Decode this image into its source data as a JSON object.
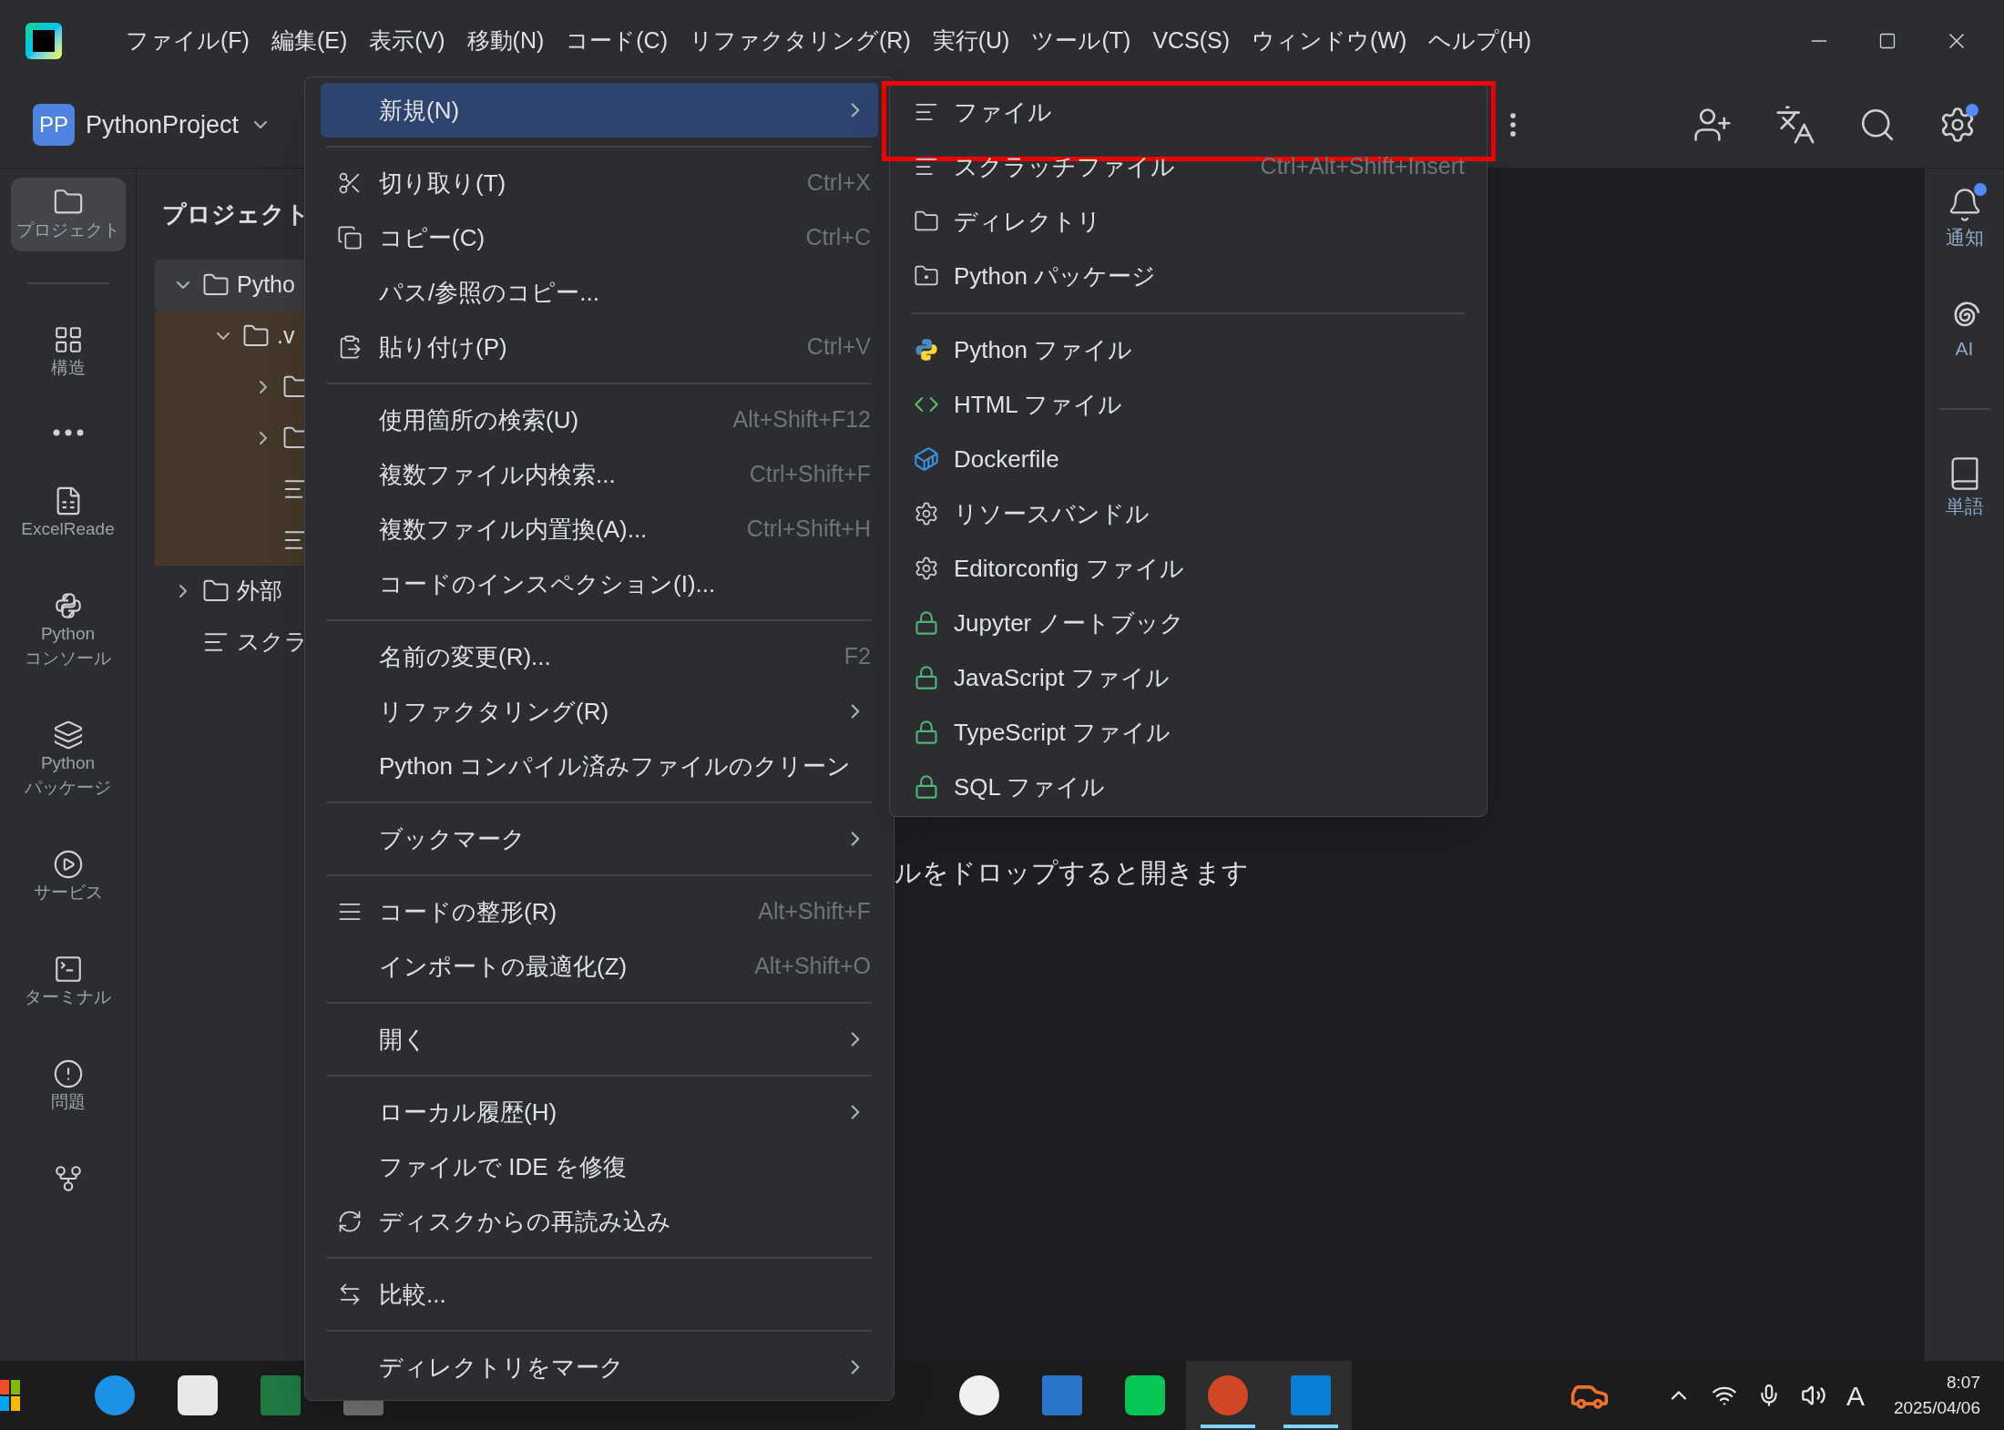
{
  "title_bar": {
    "menu": [
      "ファイル(F)",
      "編集(E)",
      "表示(V)",
      "移動(N)",
      "コード(C)",
      "リファクタリング(R)",
      "実行(U)",
      "ツール(T)",
      "VCS(S)",
      "ウィンドウ(W)",
      "ヘルプ(H)"
    ]
  },
  "toolbar": {
    "project_badge": "PP",
    "project_name": "PythonProject",
    "settings_dot": true
  },
  "left_tools": [
    {
      "lines": [
        "プロジェクト"
      ],
      "selected": true
    },
    {
      "lines": [
        "構造"
      ],
      "selected": false
    },
    {
      "selected": false
    },
    {
      "lines": [
        "ExcelReade"
      ],
      "selected": false
    },
    {
      "lines": [
        "Python",
        "コンソール"
      ],
      "selected": false
    },
    {
      "lines": [
        "Python",
        "パッケージ"
      ],
      "selected": false
    },
    {
      "lines": [
        "サービス"
      ],
      "selected": false
    },
    {
      "lines": [
        "ターミナル"
      ],
      "selected": false
    },
    {
      "lines": [
        "問題"
      ],
      "selected": false
    },
    {
      "selected": false
    }
  ],
  "project_panel": {
    "title": "プロジェクト",
    "tree": [
      {
        "label": "Pytho",
        "expanded": true,
        "selected": true,
        "excluded": false,
        "children": [
          {
            "label": ".v",
            "expanded": true,
            "selected": false,
            "excluded": true,
            "children": [
              {
                "expanded": false,
                "selected": false
              },
              {
                "expanded": false,
                "selected": false
              },
              {
                "selected": false
              },
              {
                "selected": false
              }
            ]
          }
        ]
      },
      {
        "label": "外部",
        "expanded": false,
        "selected": false,
        "excluded": false
      },
      {
        "label": "スクラ",
        "selected": false,
        "excluded": false
      }
    ]
  },
  "editor": {
    "hint": "ルをドロップすると開きます"
  },
  "context_menu": {
    "items": [
      {
        "kind": "item",
        "label": "新規(N)",
        "submenu": true,
        "selected": true
      },
      {
        "kind": "separator"
      },
      {
        "kind": "item",
        "label": "切り取り(T)",
        "shortcut": "Ctrl+X",
        "submenu": false,
        "selected": false
      },
      {
        "kind": "item",
        "label": "コピー(C)",
        "shortcut": "Ctrl+C",
        "submenu": false,
        "selected": false
      },
      {
        "kind": "item",
        "label": "パス/参照のコピー...",
        "submenu": false,
        "selected": false
      },
      {
        "kind": "item",
        "label": "貼り付け(P)",
        "shortcut": "Ctrl+V",
        "submenu": false,
        "selected": false
      },
      {
        "kind": "separator"
      },
      {
        "kind": "item",
        "label": "使用箇所の検索(U)",
        "shortcut": "Alt+Shift+F12",
        "submenu": false,
        "selected": false
      },
      {
        "kind": "item",
        "label": "複数ファイル内検索...",
        "shortcut": "Ctrl+Shift+F",
        "submenu": false,
        "selected": false
      },
      {
        "kind": "item",
        "label": "複数ファイル内置換(A)...",
        "shortcut": "Ctrl+Shift+H",
        "submenu": false,
        "selected": false
      },
      {
        "kind": "item",
        "label": "コードのインスペクション(I)...",
        "submenu": false,
        "selected": false
      },
      {
        "kind": "separator"
      },
      {
        "kind": "item",
        "label": "名前の変更(R)...",
        "shortcut": "F2",
        "submenu": false,
        "selected": false
      },
      {
        "kind": "item",
        "label": "リファクタリング(R)",
        "submenu": true,
        "selected": false
      },
      {
        "kind": "item",
        "label": "Python コンパイル済みファイルのクリーン",
        "submenu": false,
        "selected": false
      },
      {
        "kind": "separator"
      },
      {
        "kind": "item",
        "label": "ブックマーク",
        "submenu": true,
        "selected": false
      },
      {
        "kind": "separator"
      },
      {
        "kind": "item",
        "label": "コードの整形(R)",
        "shortcut": "Alt+Shift+F",
        "submenu": false,
        "selected": false
      },
      {
        "kind": "item",
        "label": "インポートの最適化(Z)",
        "shortcut": "Alt+Shift+O",
        "submenu": false,
        "selected": false
      },
      {
        "kind": "separator"
      },
      {
        "kind": "item",
        "label": "開く",
        "submenu": true,
        "selected": false
      },
      {
        "kind": "separator"
      },
      {
        "kind": "item",
        "label": "ローカル履歴(H)",
        "submenu": true,
        "selected": false
      },
      {
        "kind": "item",
        "label": "ファイルで IDE を修復",
        "submenu": false,
        "selected": false
      },
      {
        "kind": "item",
        "label": "ディスクからの再読み込み",
        "submenu": false,
        "selected": false
      },
      {
        "kind": "separator"
      },
      {
        "kind": "item",
        "label": "比較...",
        "submenu": false,
        "selected": false
      },
      {
        "kind": "separator"
      },
      {
        "kind": "item",
        "label": "ディレクトリをマーク",
        "submenu": true,
        "selected": false
      }
    ]
  },
  "submenu": {
    "items": [
      {
        "kind": "item",
        "label": "ファイル",
        "highlighted": true
      },
      {
        "kind": "item",
        "label": "スクラッチファイル",
        "shortcut": "Ctrl+Alt+Shift+Insert",
        "highlighted": false
      },
      {
        "kind": "item",
        "label": "ディレクトリ",
        "highlighted": false
      },
      {
        "kind": "item",
        "label": "Python パッケージ",
        "highlighted": false
      },
      {
        "kind": "separator"
      },
      {
        "kind": "item",
        "label": "Python ファイル",
        "highlighted": false
      },
      {
        "kind": "item",
        "label": "HTML ファイル",
        "highlighted": false
      },
      {
        "kind": "item",
        "label": "Dockerfile",
        "highlighted": false
      },
      {
        "kind": "item",
        "label": "リソースバンドル",
        "highlighted": false
      },
      {
        "kind": "item",
        "label": "Editorconfig ファイル",
        "highlighted": false
      },
      {
        "kind": "item",
        "label": "Jupyter ノートブック",
        "highlighted": false
      },
      {
        "kind": "item",
        "label": "JavaScript ファイル",
        "highlighted": false
      },
      {
        "kind": "item",
        "label": "TypeScript ファイル",
        "highlighted": false
      },
      {
        "kind": "item",
        "label": "SQL ファイル",
        "highlighted": false
      }
    ]
  },
  "right_tools": [
    {
      "lines": [
        "通知"
      ],
      "dot": true
    },
    {
      "lines": [
        "AI"
      ],
      "dot": false
    },
    {
      "lines": [
        "単語"
      ],
      "dot": false
    }
  ],
  "taskbar": {
    "apps_left": [
      {
        "running": false
      },
      {
        "running": false
      },
      {
        "running": false
      },
      {
        "running": false
      }
    ],
    "apps_right": [
      {
        "running": false
      },
      {
        "running": false
      },
      {
        "running": false
      },
      {
        "running": true
      },
      {
        "running": true
      }
    ],
    "ime": "A",
    "time": "8:07",
    "date": "2025/04/06"
  }
}
